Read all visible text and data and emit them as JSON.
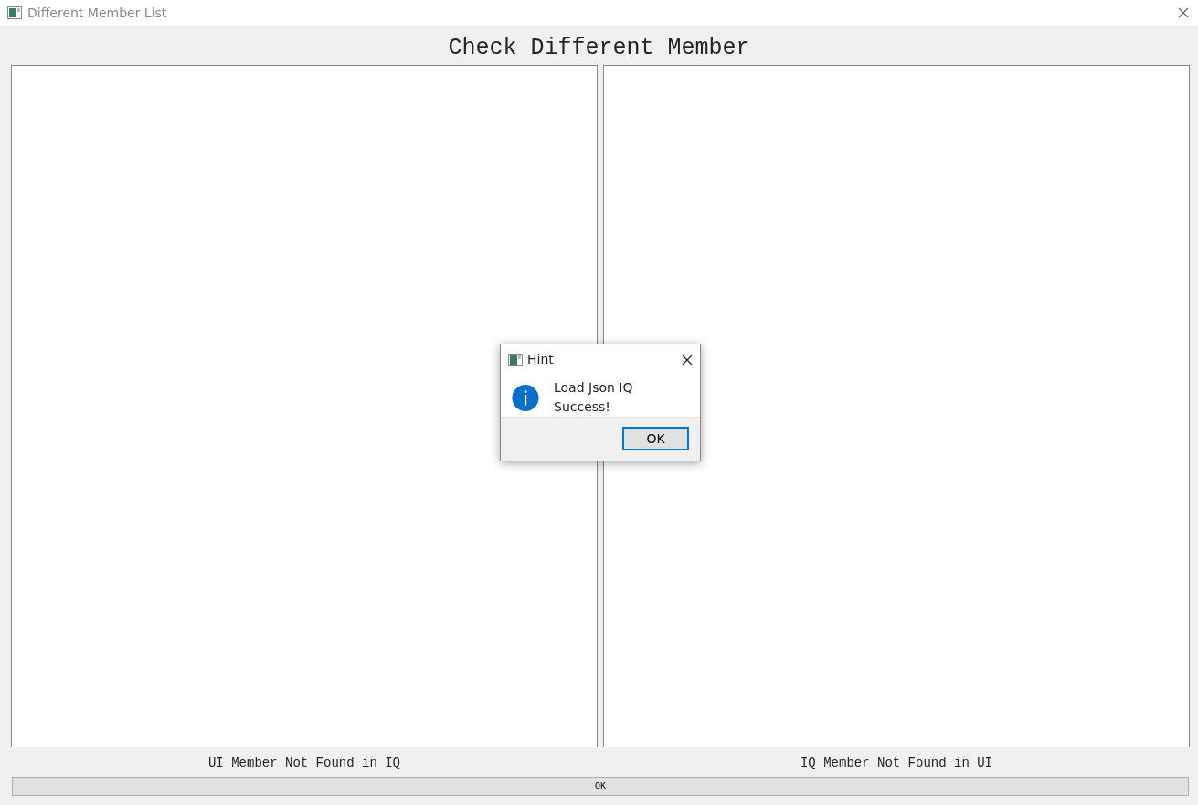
{
  "window": {
    "title": "Different Member List"
  },
  "heading": "Check Different Member",
  "lists": [
    {
      "label": "UI Member Not Found in IQ"
    },
    {
      "label": "IQ Member Not Found in UI"
    }
  ],
  "ok_button": "OK",
  "dialog": {
    "title": "Hint",
    "message": "Load Json IQ Success!",
    "button": "OK"
  }
}
